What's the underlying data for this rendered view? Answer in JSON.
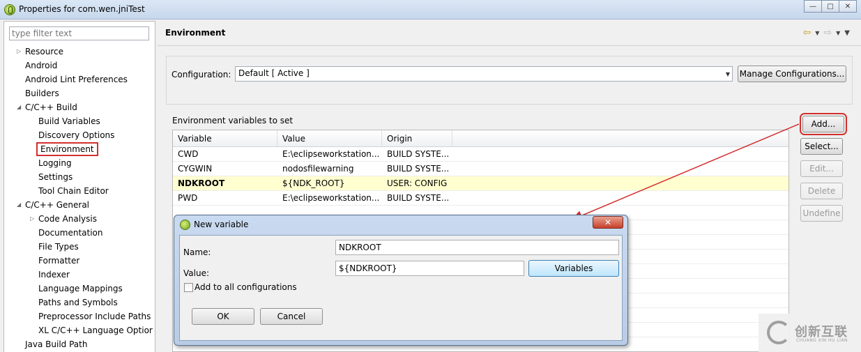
{
  "window": {
    "title": "Properties for com.wen.jniTest",
    "min_label": "—",
    "max_label": "□",
    "close_label": "✕"
  },
  "sidebar": {
    "filter_placeholder": "type filter text",
    "items": [
      {
        "label": "Resource",
        "indent": 0,
        "arrow": "▷"
      },
      {
        "label": "Android",
        "indent": 0,
        "arrow": ""
      },
      {
        "label": "Android Lint Preferences",
        "indent": 0,
        "arrow": ""
      },
      {
        "label": "Builders",
        "indent": 0,
        "arrow": ""
      },
      {
        "label": "C/C++ Build",
        "indent": 0,
        "arrow": "◢"
      },
      {
        "label": "Build Variables",
        "indent": 1,
        "arrow": ""
      },
      {
        "label": "Discovery Options",
        "indent": 1,
        "arrow": ""
      },
      {
        "label": "Environment",
        "indent": 1,
        "arrow": "",
        "selected": true
      },
      {
        "label": "Logging",
        "indent": 1,
        "arrow": ""
      },
      {
        "label": "Settings",
        "indent": 1,
        "arrow": ""
      },
      {
        "label": "Tool Chain Editor",
        "indent": 1,
        "arrow": ""
      },
      {
        "label": "C/C++ General",
        "indent": 0,
        "arrow": "◢"
      },
      {
        "label": "Code Analysis",
        "indent": 1,
        "arrow": "▷"
      },
      {
        "label": "Documentation",
        "indent": 1,
        "arrow": ""
      },
      {
        "label": "File Types",
        "indent": 1,
        "arrow": ""
      },
      {
        "label": "Formatter",
        "indent": 1,
        "arrow": ""
      },
      {
        "label": "Indexer",
        "indent": 1,
        "arrow": ""
      },
      {
        "label": "Language Mappings",
        "indent": 1,
        "arrow": ""
      },
      {
        "label": "Paths and Symbols",
        "indent": 1,
        "arrow": ""
      },
      {
        "label": "Preprocessor Include Paths",
        "indent": 1,
        "arrow": ""
      },
      {
        "label": "XL C/C++ Language Optior",
        "indent": 1,
        "arrow": ""
      },
      {
        "label": "Java Build Path",
        "indent": 0,
        "arrow": ""
      }
    ]
  },
  "main": {
    "title": "Environment",
    "configuration_label": "Configuration:",
    "configuration_value": "Default  [ Active ]",
    "manage_configs_label": "Manage Configurations...",
    "envvars_label": "Environment variables to set",
    "columns": [
      "Variable",
      "Value",
      "Origin"
    ],
    "rows": [
      {
        "variable": "CWD",
        "value": "E:\\eclipseworkstation...",
        "origin": "BUILD SYSTE...",
        "bold": false
      },
      {
        "variable": "CYGWIN",
        "value": "nodosfilewarning",
        "origin": "BUILD SYSTE...",
        "bold": false
      },
      {
        "variable": "NDKROOT",
        "value": "${NDK_ROOT}",
        "origin": "USER: CONFIG",
        "bold": true
      },
      {
        "variable": "PWD",
        "value": "E:\\eclipseworkstation...",
        "origin": "BUILD SYSTE...",
        "bold": false
      }
    ],
    "buttons": {
      "add": "Add...",
      "select": "Select...",
      "edit": "Edit...",
      "delete": "Delete",
      "undefine": "Undefine"
    }
  },
  "dialog": {
    "title": "New variable",
    "close_label": "✕",
    "name_label": "Name:",
    "name_value": "NDKROOT",
    "value_label": "Value:",
    "value_value": "${NDKROOT}",
    "variables_button": "Variables",
    "add_all_label": "Add to all configurations",
    "ok_label": "OK",
    "cancel_label": "Cancel"
  },
  "watermark": {
    "text": "创新互联",
    "subtext": "CHUANG XIN HU LIAN"
  },
  "colors": {
    "highlight_red": "#d32f2f",
    "bold_row_bg": "#ffffd0"
  }
}
